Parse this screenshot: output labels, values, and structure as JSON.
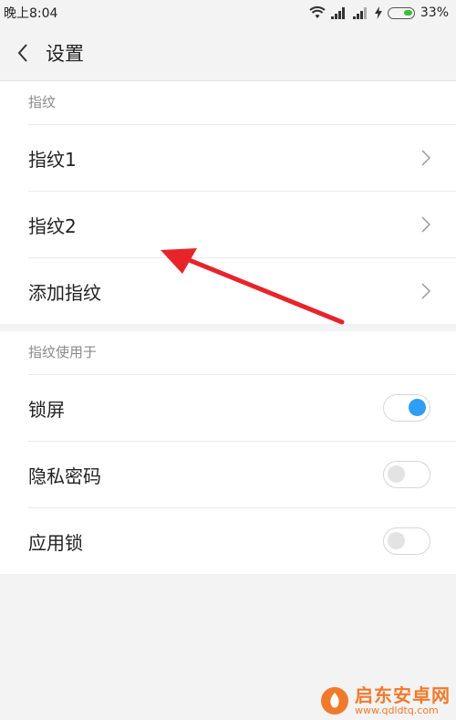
{
  "status_bar": {
    "time": "晚上8:04",
    "battery": "33%"
  },
  "header": {
    "title": "设置"
  },
  "fingerprints_section": {
    "label": "指纹",
    "items": [
      {
        "label": "指纹1"
      },
      {
        "label": "指纹2"
      },
      {
        "label": "添加指纹"
      }
    ]
  },
  "usage_section": {
    "label": "指纹使用于",
    "items": [
      {
        "label": "锁屏",
        "enabled": true
      },
      {
        "label": "隐私密码",
        "enabled": false
      },
      {
        "label": "应用锁",
        "enabled": false
      }
    ]
  },
  "watermark": {
    "title": "启东安卓网",
    "url": "www.qdldtq.com"
  },
  "colors": {
    "accent": "#2f9ef4",
    "annotation_arrow": "#e8242b",
    "watermark": "#f07a2b"
  }
}
